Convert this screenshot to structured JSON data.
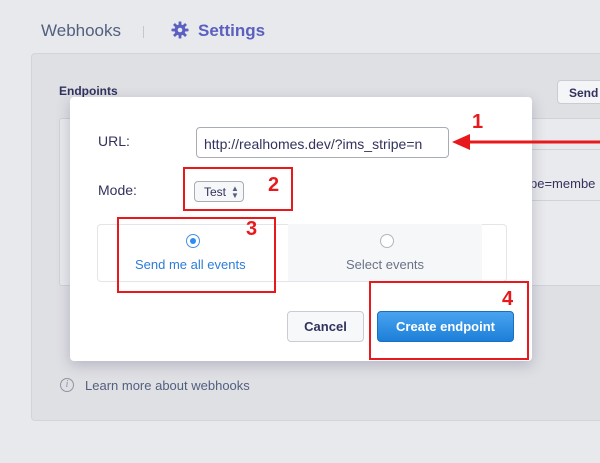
{
  "topbar": {
    "tab_webhooks": "Webhooks",
    "tab_settings": "Settings"
  },
  "background": {
    "panel_title": "Endpoints",
    "send_button": "Send t",
    "row_text": "pe=membe",
    "learn_more": "Learn more about webhooks",
    "info_icon": "i"
  },
  "modal": {
    "url_label": "URL:",
    "url_value": "http://realhomes.dev/?ims_stripe=n",
    "mode_label": "Mode:",
    "mode_value": "Test",
    "option_all": "Send me all events",
    "option_select": "Select events",
    "cancel_label": "Cancel",
    "create_label": "Create endpoint",
    "selected_option": "Send me all events"
  },
  "annotations": {
    "n1": "1",
    "n2": "2",
    "n3": "3",
    "n4": "4"
  },
  "colors": {
    "accent": "#5a5fc0",
    "primary_button": "#1c7fd8",
    "annotation": "#e8191c",
    "link": "#2d7cd6"
  },
  "icons": {
    "settings": "gear-icon",
    "info": "info-icon",
    "select_arrows": "updown-icon",
    "pointer": "arrow-icon"
  }
}
